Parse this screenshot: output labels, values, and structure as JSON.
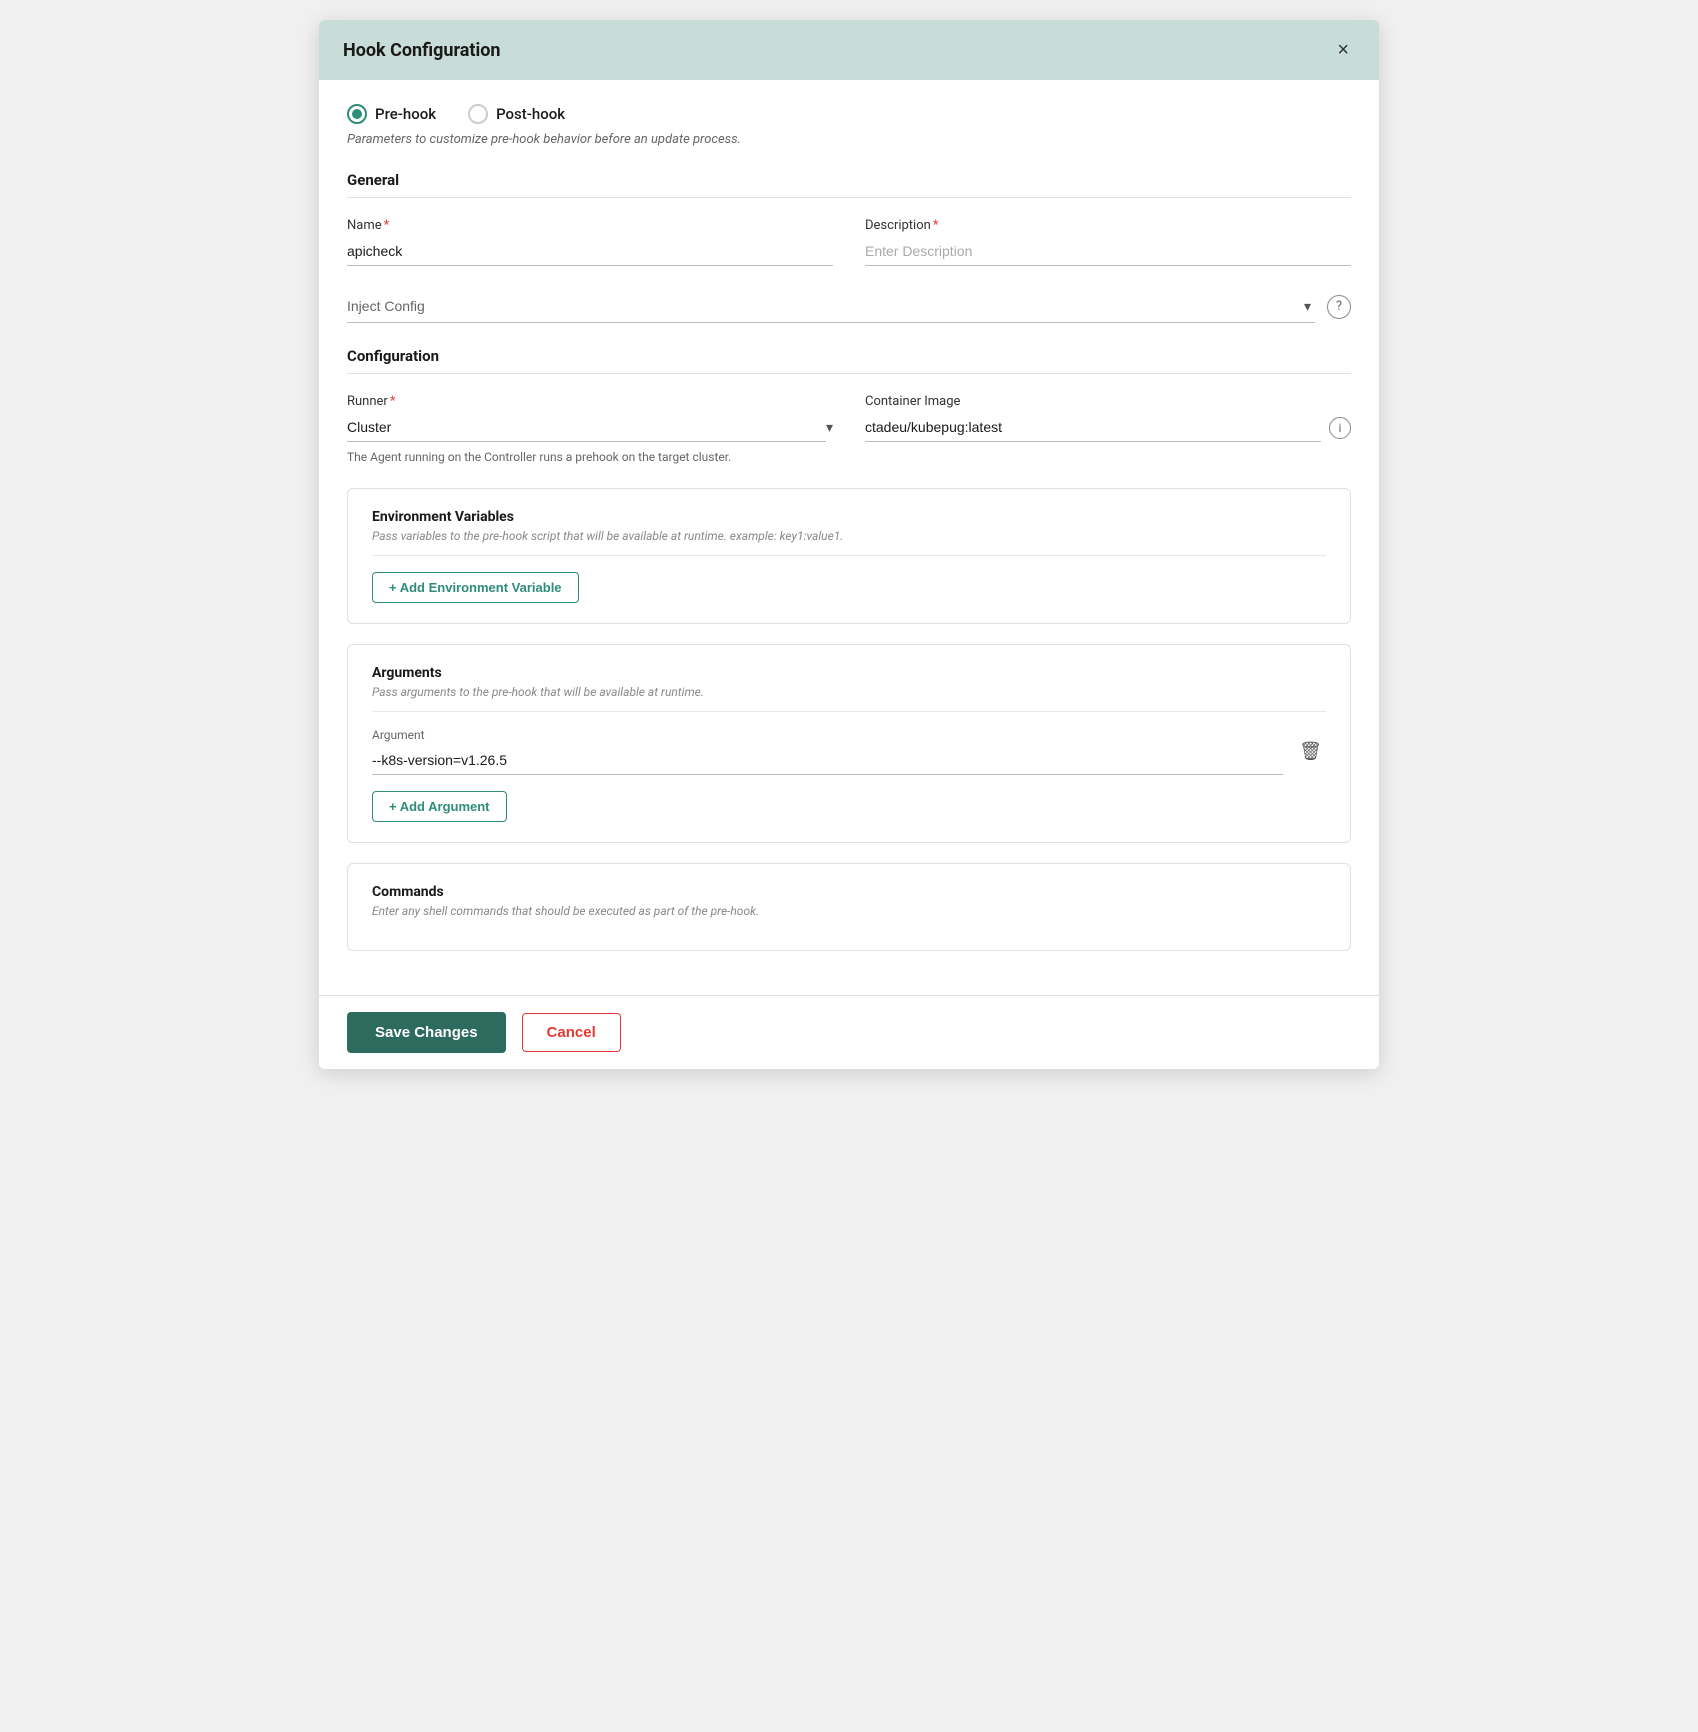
{
  "modal": {
    "title": "Hook Configuration",
    "close_label": "×"
  },
  "hook_type": {
    "prehook_label": "Pre-hook",
    "posthook_label": "Post-hook",
    "selected": "prehook",
    "description": "Parameters to customize pre-hook behavior before an update process."
  },
  "general": {
    "section_title": "General",
    "name_label": "Name",
    "name_value": "apicheck",
    "name_placeholder": "",
    "description_label": "Description",
    "description_placeholder": "Enter Description",
    "inject_config_label": "Inject Config",
    "inject_config_placeholder": "Inject Config",
    "help_icon": "?"
  },
  "configuration": {
    "section_title": "Configuration",
    "runner_label": "Runner",
    "runner_value": "Cluster",
    "runner_hint": "The Agent running on the Controller runs a prehook on the target cluster.",
    "container_image_label": "Container Image",
    "container_image_value": "ctadeu/kubepug:latest",
    "info_icon": "i"
  },
  "env_vars": {
    "title": "Environment Variables",
    "description": "Pass variables to the pre-hook script that will be available at runtime. example: key1:value1.",
    "add_btn_label": "+ Add Environment Variable"
  },
  "arguments": {
    "title": "Arguments",
    "description": "Pass arguments to the pre-hook that will be available at runtime.",
    "argument_label": "Argument",
    "argument_value": "--k8s-version=v1.26.5",
    "add_btn_label": "+ Add Argument"
  },
  "commands": {
    "title": "Commands",
    "description": "Enter any shell commands that should be executed as part of the pre-hook."
  },
  "footer": {
    "save_label": "Save Changes",
    "cancel_label": "Cancel"
  }
}
